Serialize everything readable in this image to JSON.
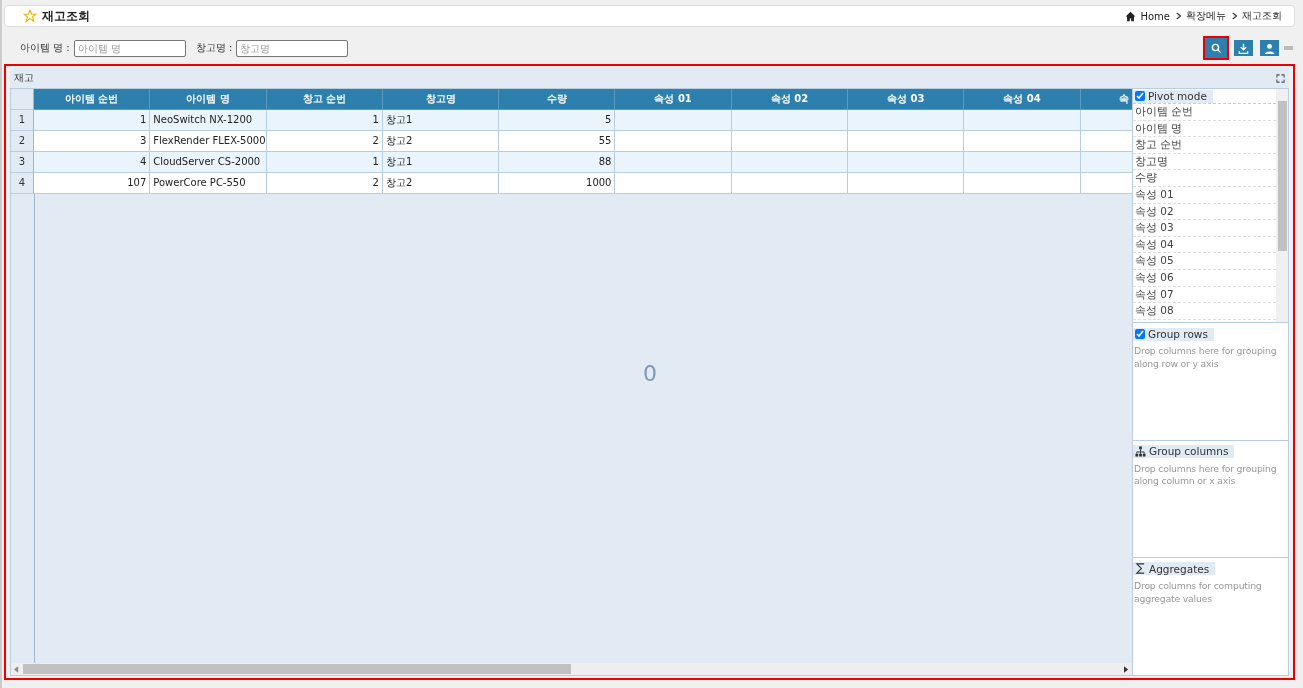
{
  "header": {
    "title": "재고조회",
    "breadcrumb": [
      "Home",
      "확장메뉴",
      "재고조회"
    ]
  },
  "search": {
    "fields": [
      {
        "label": "아이템 명 :",
        "placeholder": "아이템 명"
      },
      {
        "label": "창고명 :",
        "placeholder": "창고명"
      }
    ],
    "buttons": [
      {
        "kind": "search",
        "highlighted": true
      },
      {
        "kind": "download",
        "highlighted": false
      },
      {
        "kind": "user",
        "highlighted": false
      }
    ]
  },
  "grid": {
    "title": "재고",
    "overlay_text": "0",
    "columns": [
      {
        "label": "아이템 순번",
        "kind": "number"
      },
      {
        "label": "아이템 명",
        "kind": "text"
      },
      {
        "label": "창고 순번",
        "kind": "number"
      },
      {
        "label": "창고명",
        "kind": "text"
      },
      {
        "label": "수량",
        "kind": "number"
      },
      {
        "label": "속성 01",
        "kind": "text"
      },
      {
        "label": "속성 02",
        "kind": "text"
      },
      {
        "label": "속성 03",
        "kind": "text"
      },
      {
        "label": "속성 04",
        "kind": "text"
      },
      {
        "label": "속",
        "kind": "text"
      }
    ],
    "rows": [
      {
        "num": "1",
        "cells": [
          "1",
          "NeoSwitch NX-1200",
          "1",
          "창고1",
          "5",
          "",
          "",
          "",
          "",
          ""
        ]
      },
      {
        "num": "2",
        "cells": [
          "3",
          "FlexRender FLEX-5000",
          "2",
          "창고2",
          "55",
          "",
          "",
          "",
          "",
          ""
        ]
      },
      {
        "num": "3",
        "cells": [
          "4",
          "CloudServer CS-2000",
          "1",
          "창고1",
          "88",
          "",
          "",
          "",
          "",
          ""
        ]
      },
      {
        "num": "4",
        "cells": [
          "107",
          "PowerCore PC-550",
          "2",
          "창고2",
          "1000",
          "",
          "",
          "",
          "",
          ""
        ]
      }
    ],
    "side_panel": {
      "pivot_mode": {
        "label": "Pivot mode",
        "checked": true
      },
      "columns": [
        "아이템 순번",
        "아이템 명",
        "창고 순번",
        "창고명",
        "수량",
        "속성 01",
        "속성 02",
        "속성 03",
        "속성 04",
        "속성 05",
        "속성 06",
        "속성 07",
        "속성 08"
      ],
      "sections": [
        {
          "kind": "rows",
          "label": "Group rows",
          "checked": true,
          "hint": "Drop columns here for grouping along row or y axis"
        },
        {
          "kind": "columns",
          "label": "Group columns",
          "hint": "Drop columns here for grouping along column or x axis"
        },
        {
          "kind": "aggregates",
          "label": "Aggregates",
          "hint": "Drop columns for computing aggregate values"
        }
      ]
    }
  }
}
